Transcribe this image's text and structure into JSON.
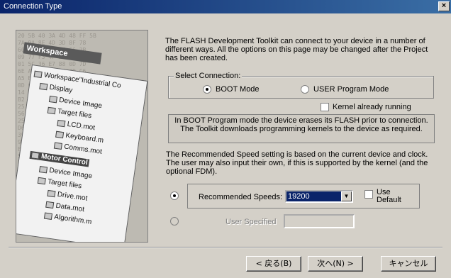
{
  "window": {
    "title": "Connection Type",
    "close_label": "×"
  },
  "illustration": {
    "workspace_label": "Workspace",
    "tree": [
      {
        "label": "Workspace\"Industrial Co",
        "bold": false
      },
      {
        "label": "Display",
        "bold": false
      },
      {
        "label": "Device Image",
        "bold": false
      },
      {
        "label": "Target files",
        "bold": false
      },
      {
        "label": "LCD.mot",
        "bold": false
      },
      {
        "label": "Keyboard.m",
        "bold": false
      },
      {
        "label": "Comms.mot",
        "bold": false
      },
      {
        "label": "Motor Control",
        "bold": true
      },
      {
        "label": "Device Image",
        "bold": false
      },
      {
        "label": "Target files",
        "bold": false
      },
      {
        "label": "Drive.mot",
        "bold": false
      },
      {
        "label": "Data.mot",
        "bold": false
      },
      {
        "label": "Algorithm.m",
        "bold": false
      }
    ]
  },
  "description": "The FLASH Development Toolkit can connect to your device in a number of different ways. All the options on this page may be changed after the Project has been created.",
  "select_connection": {
    "legend": "Select Connection:",
    "boot_label": "BOOT Mode",
    "user_label": "USER Program Mode",
    "selected": "boot"
  },
  "kernel_running": {
    "label": "Kernel already running",
    "checked": false
  },
  "info_text": "In BOOT Program mode the device erases its FLASH prior to connection. The Toolkit downloads programming kernels to the device as required.",
  "speed_description": "The Recommended Speed setting is based on the current device and clock. The user may also input their own, if this is supported by the kernel (and the optional FDM).",
  "recommended": {
    "label": "Recommended Speeds:",
    "value": "19200",
    "selected": true
  },
  "use_default": {
    "label_line1": "Use",
    "label_line2": "Default",
    "checked": false
  },
  "user_specified": {
    "label": "User Specified",
    "value": ""
  },
  "buttons": {
    "back": "< 戻る(B)",
    "next": "次へ(N) >",
    "cancel": "キャンセル"
  }
}
